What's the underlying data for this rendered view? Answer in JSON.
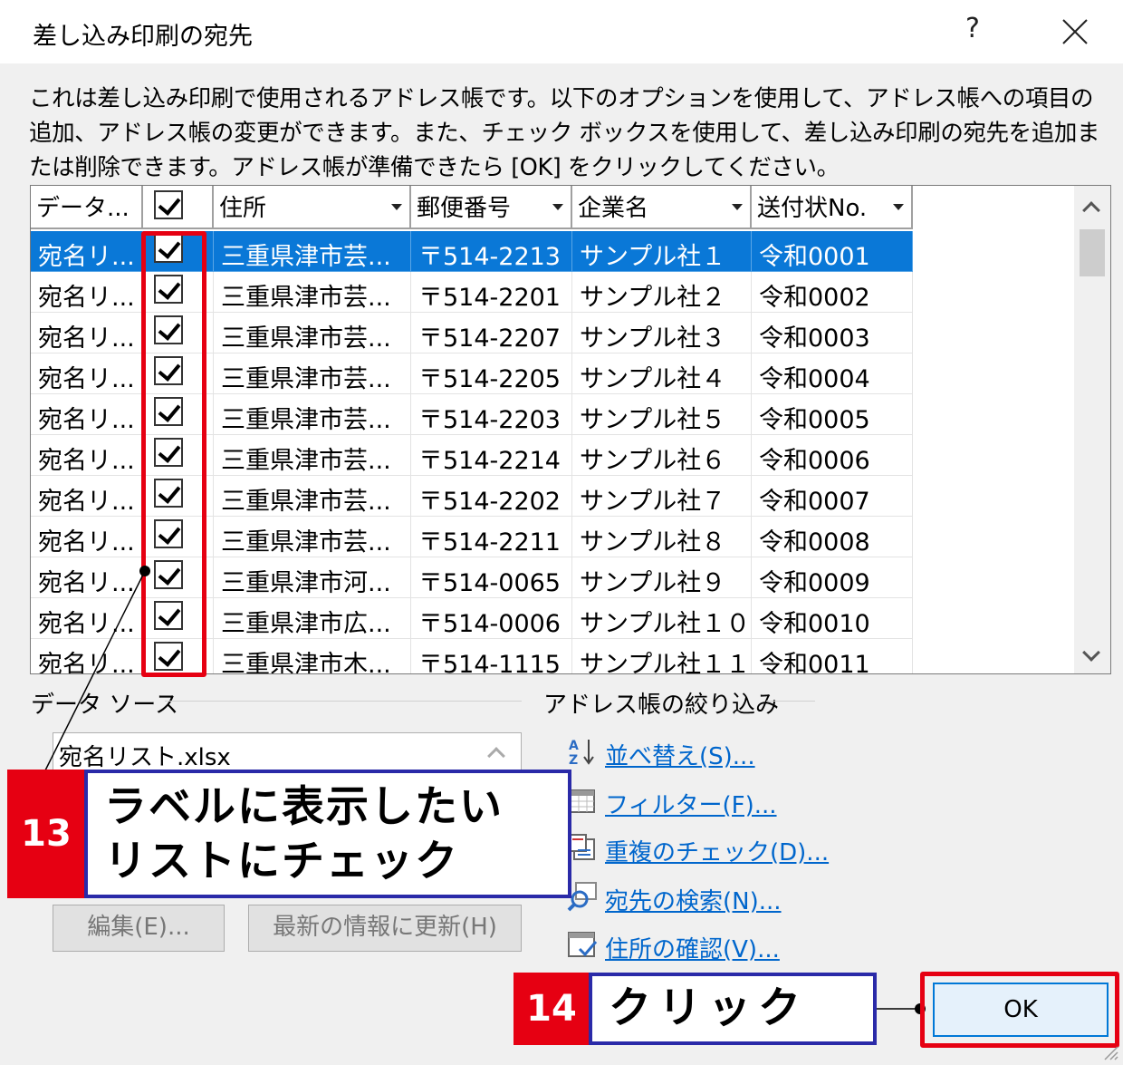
{
  "window": {
    "title": "差し込み印刷の宛先",
    "help_label": "?"
  },
  "description": "これは差し込み印刷で使用されるアドレス帳です。以下のオプションを使用して、アドレス帳への項目の追加、アドレス帳の変更ができます。また、チェック ボックスを使用して、差し込み印刷の宛先を追加または削除できます。アドレス帳が準備できたら [OK] をクリックしてください。",
  "table": {
    "columns": [
      "データ...",
      "",
      "住所",
      "郵便番号",
      "企業名",
      "送付状No."
    ],
    "rows": [
      [
        "宛名リ...",
        true,
        "三重県津市芸...",
        "〒514-2213",
        "サンプル社１",
        "令和0001"
      ],
      [
        "宛名リ...",
        true,
        "三重県津市芸...",
        "〒514-2201",
        "サンプル社２",
        "令和0002"
      ],
      [
        "宛名リ...",
        true,
        "三重県津市芸...",
        "〒514-2207",
        "サンプル社３",
        "令和0003"
      ],
      [
        "宛名リ...",
        true,
        "三重県津市芸...",
        "〒514-2205",
        "サンプル社４",
        "令和0004"
      ],
      [
        "宛名リ...",
        true,
        "三重県津市芸...",
        "〒514-2203",
        "サンプル社５",
        "令和0005"
      ],
      [
        "宛名リ...",
        true,
        "三重県津市芸...",
        "〒514-2214",
        "サンプル社６",
        "令和0006"
      ],
      [
        "宛名リ...",
        true,
        "三重県津市芸...",
        "〒514-2202",
        "サンプル社７",
        "令和0007"
      ],
      [
        "宛名リ...",
        true,
        "三重県津市芸...",
        "〒514-2211",
        "サンプル社８",
        "令和0008"
      ],
      [
        "宛名リ...",
        true,
        "三重県津市河...",
        "〒514-0065",
        "サンプル社９",
        "令和0009"
      ],
      [
        "宛名リ...",
        true,
        "三重県津市広...",
        "〒514-0006",
        "サンプル社１０",
        "令和0010"
      ],
      [
        "宛名リ...",
        true,
        "三重県津市木...",
        "〒514-1115",
        "サンプル社１１",
        "令和0011"
      ]
    ],
    "selected_row": 0
  },
  "data_source": {
    "heading": "データ ソース",
    "selected": "宛名リスト.xlsx",
    "edit_button": "編集(E)...",
    "refresh_button": "最新の情報に更新(H)"
  },
  "refine": {
    "heading": "アドレス帳の絞り込み",
    "links": [
      {
        "label": "並べ替え(S)...",
        "icon": "sort-az-icon"
      },
      {
        "label": "フィルター(F)...",
        "icon": "filter-icon"
      },
      {
        "label": "重複のチェック(D)...",
        "icon": "duplicate-check-icon"
      },
      {
        "label": "宛先の検索(N)...",
        "icon": "search-icon"
      },
      {
        "label": "住所の確認(V)...",
        "icon": "validate-address-icon"
      }
    ]
  },
  "ok_button": "OK",
  "callouts": [
    {
      "number": "13",
      "line1": "ラベルに表示したい",
      "line2": "リストにチェック"
    },
    {
      "number": "14",
      "text": "クリック"
    }
  ],
  "colors": {
    "highlight_red": "#e60012",
    "callout_border": "#2a2aa8",
    "selection_blue": "#0a78d7",
    "link_blue": "#0066cc"
  }
}
